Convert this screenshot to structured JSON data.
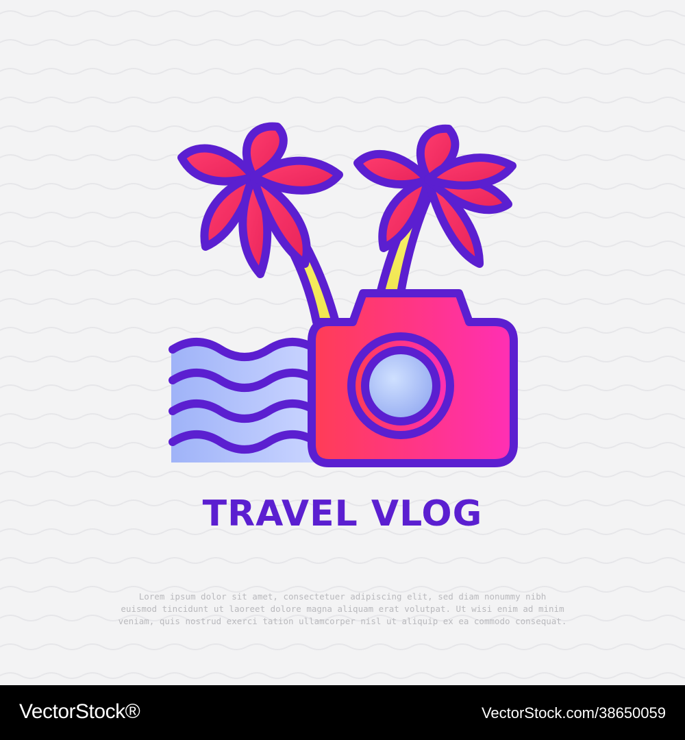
{
  "title": "TRAVEL VLOG",
  "body_text": [
    "Lorem ipsum dolor sit amet, consectetuer adipiscing elit, sed diam nonummy nibh",
    "euismod tincidunt ut laoreet dolore magna aliquam erat volutpat. Ut wisi enim ad minim",
    "veniam, quis nostrud exerci tation ullamcorper nisl ut aliquip ex ea commodo consequat."
  ],
  "footer": {
    "brand": "VectorStock®",
    "stock_id": "VectorStock.com/38650059"
  },
  "icons": [
    "palm-tree-icon",
    "palm-tree-icon",
    "waves-icon",
    "camera-icon"
  ],
  "colors": {
    "background": "#f3f3f4",
    "outline": "#5b1fd0",
    "camera_red": "#ff3f5e",
    "camera_pink": "#ff2fb0",
    "wave_light": "#a8b8f5",
    "trunk_yellow": "#f6ef6a",
    "footer": "#000000"
  }
}
